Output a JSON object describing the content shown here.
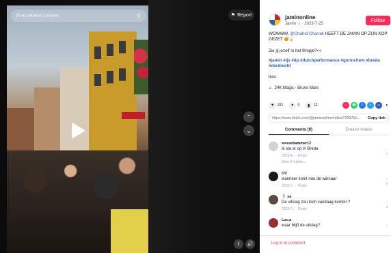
{
  "player": {
    "search_placeholder": "Find related content",
    "search_icon": "search-icon",
    "report_label": "Report",
    "report_icon": "flag-icon",
    "play_icon": "play-icon",
    "nav_up_icon": "chevron-up-icon",
    "nav_down_icon": "chevron-down-icon",
    "float_icon": "float-icon",
    "volume_icon": "volume-icon"
  },
  "author": {
    "name": "jaminonline",
    "display_name": "Jamin",
    "date": "2023-7-25",
    "follow_label": "Follow",
    "follow_color": "#fe2c55"
  },
  "caption": {
    "prefix": "WOWWW, ",
    "mention": "@Chahid Charrak",
    "suffix": " HEEFT DE JAMIN OP ZIJN KOP GEZET 😅🍦",
    "line2": "Zie jij jezelf in het filmpje?👀",
    "hashtags": "#jamin #ijs #dp #dutchperformance #gorinchem #breda #dordrecht",
    "less_label": "less"
  },
  "music": {
    "icon": "music-note-icon",
    "title": "24K Magic - Bruno Mars"
  },
  "actions": {
    "likes": "331",
    "comments": "9",
    "saves": "12"
  },
  "link": {
    "url": "https://www.tiktok.com/@jaminonline/video/7259761...",
    "copy_label": "Copy link"
  },
  "tabs": {
    "comments": "Comments (9)",
    "creator_videos": "Creator videos"
  },
  "comments": [
    {
      "user": "wessebammer12",
      "text": "ik sta er op in Breda",
      "meta": "2023-8... · Reply",
      "likes": "1",
      "replies": "View 2 replies ⌄"
    },
    {
      "user": "OV",
      "text": "wanneer komt nou de winnaar",
      "meta": "2023-7... · Reply",
      "likes": "2",
      "replies": ""
    },
    {
      "user": "🧍 sa",
      "text": "De uitslag zou toch vandaag komen ?",
      "meta": "2023-7... · Reply",
      "likes": "2",
      "replies": ""
    },
    {
      "user": "Luc.a",
      "text": "waar blijft de uitslag?",
      "meta": "",
      "likes": "",
      "replies": ""
    }
  ],
  "comment_input": {
    "placeholder": "Log in to comment"
  },
  "colors": {
    "accent": "#fe2c55",
    "link": "#2b5db9"
  }
}
